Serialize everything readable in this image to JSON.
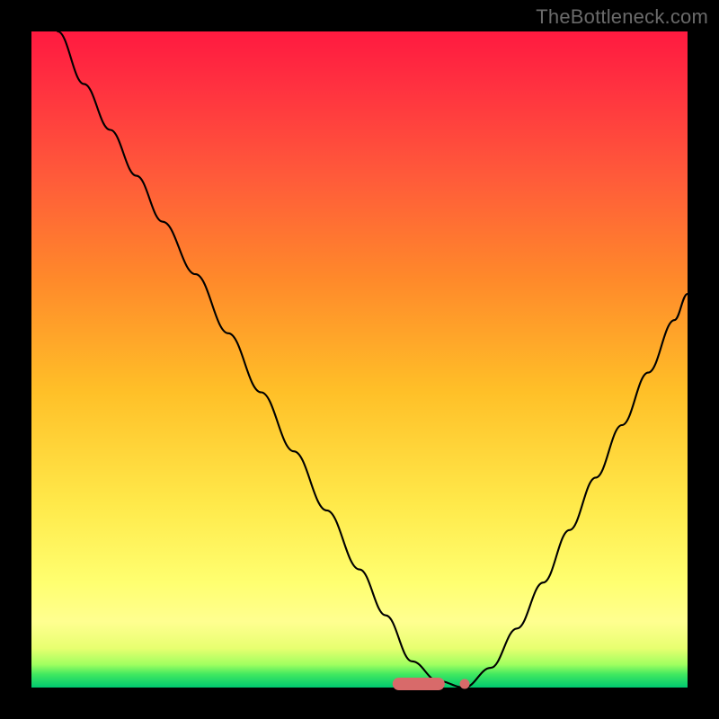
{
  "watermark": "TheBottleneck.com",
  "accent": {
    "marker": "#d86a6a",
    "curve": "#000000"
  },
  "chart_data": {
    "type": "line",
    "title": "",
    "xlabel": "",
    "ylabel": "",
    "xlim": [
      0,
      100
    ],
    "ylim": [
      0,
      100
    ],
    "notes": "Background gradient from red (bad) at top to green (good) at bottom. Single black V-shaped curve starting at top-left, descending steeply to a flat minimum around x≈55–66 at y≈0, then rising less steeply toward the right edge. A salmon horizontal marker segment sits at the flat minimum with a small dot at its right end.",
    "series": [
      {
        "name": "bottleneck-curve",
        "x": [
          4,
          8,
          12,
          16,
          20,
          25,
          30,
          35,
          40,
          45,
          50,
          54,
          58,
          62,
          66,
          70,
          74,
          78,
          82,
          86,
          90,
          94,
          98,
          100
        ],
        "values": [
          100,
          92,
          85,
          78,
          71,
          63,
          54,
          45,
          36,
          27,
          18,
          11,
          4,
          1,
          0,
          3,
          9,
          16,
          24,
          32,
          40,
          48,
          56,
          60
        ]
      }
    ],
    "marker": {
      "x_start": 55,
      "x_end": 63,
      "y": 0.5
    },
    "marker_dot": {
      "x": 66,
      "y": 0.6
    }
  }
}
